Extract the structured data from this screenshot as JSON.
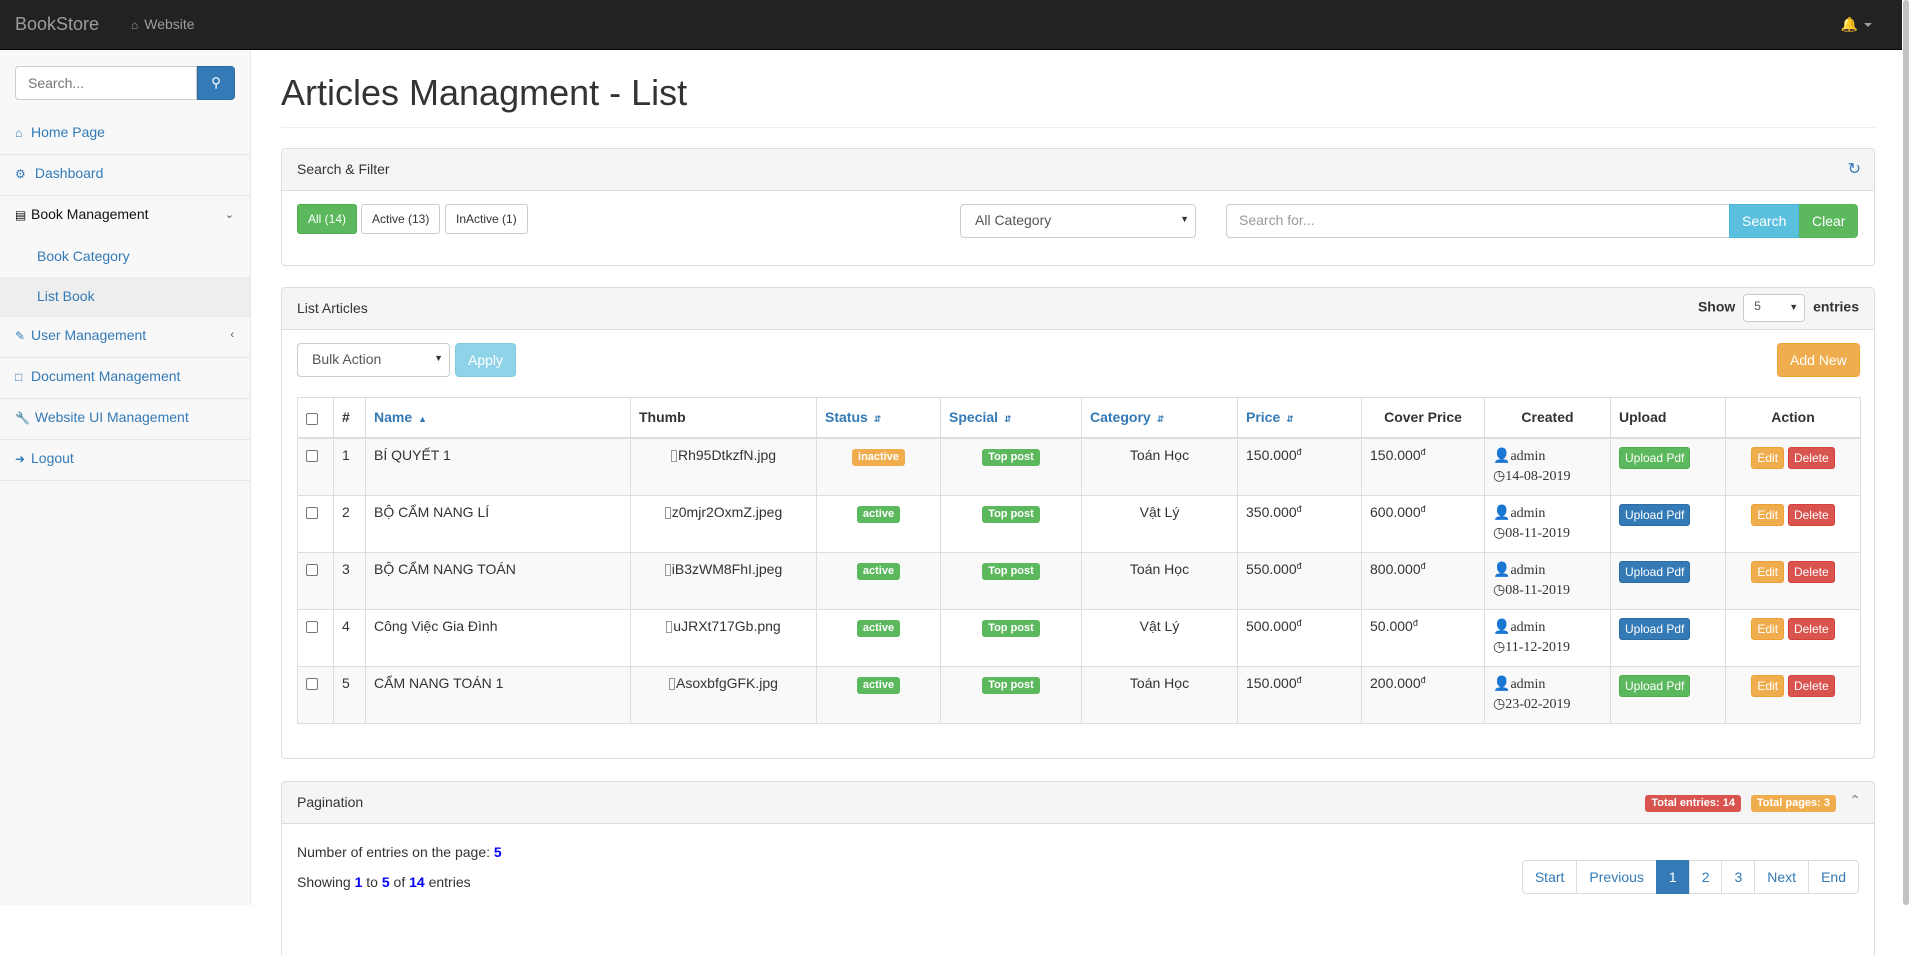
{
  "navbar": {
    "brand": "BookStore",
    "website_link": "Website"
  },
  "sidebar": {
    "search_placeholder": "Search...",
    "items": [
      {
        "label": "Home Page",
        "icon": "home-icon"
      },
      {
        "label": "Dashboard",
        "icon": "dashboard-icon"
      },
      {
        "label": "Book Management",
        "icon": "bar-chart-icon",
        "expanded": true,
        "children": [
          {
            "label": "Book Category"
          },
          {
            "label": "List Book",
            "current": true
          }
        ]
      },
      {
        "label": "User Management",
        "icon": "edit-icon"
      },
      {
        "label": "Document Management",
        "icon": "file-icon"
      },
      {
        "label": "Website UI Management",
        "icon": "wrench-icon"
      },
      {
        "label": "Logout",
        "icon": "sign-in-icon"
      }
    ]
  },
  "page": {
    "title": "Articles Managment - List"
  },
  "filter": {
    "heading": "Search & Filter",
    "status_buttons": [
      "All (14)",
      "Active (13)",
      "InActive (1)"
    ],
    "category_select": "All Category",
    "search_placeholder": "Search for...",
    "search_button": "Search",
    "clear_button": "Clear"
  },
  "list": {
    "heading": "List Articles",
    "show_label": "Show",
    "show_value": "5",
    "entries_label": "entries",
    "bulk_action": "Bulk Action",
    "apply_button": "Apply",
    "add_new_button": "Add New",
    "columns": [
      "#",
      "Name",
      "Thumb",
      "Status",
      "Special",
      "Category",
      "Price",
      "Cover Price",
      "Created",
      "Upload",
      "Action"
    ],
    "rows": [
      {
        "num": "1",
        "name": "BÍ QUYẾT 1",
        "thumb": "Rh95DtkzfN.jpg",
        "status": "inactive",
        "special": "Top post",
        "category": "Toán Học",
        "price": "150.000",
        "cover_price": "150.000",
        "created_by": "admin",
        "created_date": "14-08-2019",
        "upload": "Upload Pdf",
        "edit": "Edit",
        "delete": "Delete"
      },
      {
        "num": "2",
        "name": "BỘ CẨM NANG LÍ",
        "thumb": "z0mjr2OxmZ.jpeg",
        "status": "active",
        "special": "Top post",
        "category": "Vật Lý",
        "price": "350.000",
        "cover_price": "600.000",
        "created_by": "admin",
        "created_date": "08-11-2019",
        "upload": "Upload Pdf",
        "edit": "Edit",
        "delete": "Delete"
      },
      {
        "num": "3",
        "name": "BỘ CẨM NANG TOÁN",
        "thumb": "iB3zWM8FhI.jpeg",
        "status": "active",
        "special": "Top post",
        "category": "Toán Học",
        "price": "550.000",
        "cover_price": "800.000",
        "created_by": "admin",
        "created_date": "08-11-2019",
        "upload": "Upload Pdf",
        "edit": "Edit",
        "delete": "Delete"
      },
      {
        "num": "4",
        "name": "Công Việc Gia Đình",
        "thumb": "uJRXt717Gb.png",
        "status": "active",
        "special": "Top post",
        "category": "Vật Lý",
        "price": "500.000",
        "cover_price": "50.000",
        "created_by": "admin",
        "created_date": "11-12-2019",
        "upload": "Upload Pdf",
        "edit": "Edit",
        "delete": "Delete"
      },
      {
        "num": "5",
        "name": "CẨM NANG TOÁN 1",
        "thumb": "AsoxbfgGFK.jpg",
        "status": "active",
        "special": "Top post",
        "category": "Toán Học",
        "price": "150.000",
        "cover_price": "200.000",
        "created_by": "admin",
        "created_date": "23-02-2019",
        "upload": "Upload Pdf",
        "edit": "Edit",
        "delete": "Delete"
      }
    ],
    "currency_symbol": "đ"
  },
  "pagination": {
    "heading": "Pagination",
    "total_entries_badge": "Total entries: 14",
    "total_pages_badge": "Total pages: 3",
    "entries_on_page_label": "Number of entries on the page:",
    "entries_on_page": "5",
    "showing_prefix": "Showing",
    "showing_from": "1",
    "showing_to_word": "to",
    "showing_to": "5",
    "showing_of_word": "of",
    "showing_total": "14",
    "showing_suffix": "entries",
    "pages": [
      "Start",
      "Previous",
      "1",
      "2",
      "3",
      "Next",
      "End"
    ],
    "active_page": "1"
  },
  "colors": {
    "primary": "#337ab7",
    "success": "#5cb85c",
    "warning": "#f0ad4e",
    "danger": "#d9534f",
    "info": "#5bc0de",
    "navbar": "#222222"
  }
}
